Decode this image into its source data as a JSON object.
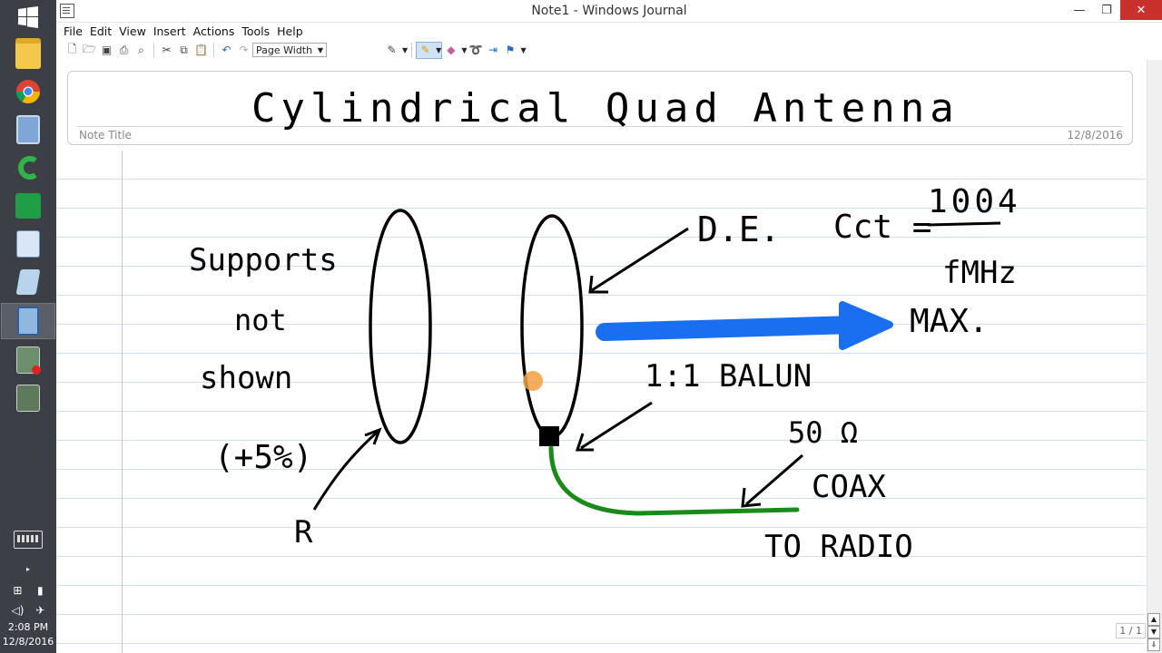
{
  "window": {
    "title": "Note1 - Windows Journal"
  },
  "menu": [
    "File",
    "Edit",
    "View",
    "Insert",
    "Actions",
    "Tools",
    "Help"
  ],
  "toolbar": {
    "zoom_value": "Page Width"
  },
  "note": {
    "title_label": "Note Title",
    "date": "12/8/2016",
    "page_indicator": "1 / 1",
    "handwritten_title": "Cylindrical Quad Antenna",
    "left_text": [
      "Supports",
      "not",
      "shown",
      "(+5%)"
    ],
    "label_reflector": "R",
    "label_de": "D.E.",
    "formula_lhs": "Cct =",
    "formula_num": "1004",
    "formula_den": "fMHz",
    "label_max": "MAX.",
    "label_balun": "1:1 BALUN",
    "label_ohms": "50 Ω",
    "label_coax": "COAX",
    "label_to_radio": "TO RADIO"
  },
  "colors": {
    "arrow_blue": "#1a6ff0",
    "coax_green": "#1a8a1a",
    "ink": "#000000",
    "cursor": "#f0a040",
    "close_button": "#c7302b"
  },
  "taskbar": {
    "time": "2:08 PM",
    "date": "12/8/2016",
    "icons": [
      "windows-start-icon",
      "file-explorer-icon",
      "chrome-icon",
      "calculator-icon",
      "camtasia-icon",
      "spreadsheet-icon",
      "wordpad-icon",
      "notepad-icon",
      "journal-icon",
      "recorder-icon",
      "terminal-icon"
    ]
  }
}
